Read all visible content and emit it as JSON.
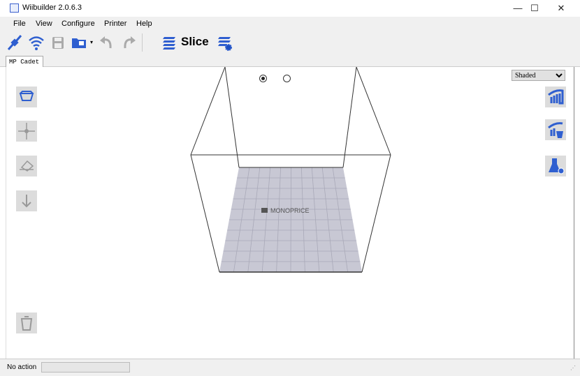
{
  "window": {
    "title": "Wiibuilder 2.0.6.3",
    "minimize": "—",
    "maximize": "☐",
    "close": "✕"
  },
  "menu": [
    "File",
    "View",
    "Configure",
    "Printer",
    "Help"
  ],
  "toolbar": {
    "slice_label": "Slice"
  },
  "tabs": [
    {
      "label": "MP Cadet"
    }
  ],
  "viewport": {
    "render_mode": "Shaded",
    "bed_logo": "MONOPRICE",
    "view_radio_selected": 0
  },
  "status": {
    "text": "No action",
    "progress": 0
  },
  "colors": {
    "accent": "#2f5fd0",
    "bed": "#c8c8d4"
  }
}
